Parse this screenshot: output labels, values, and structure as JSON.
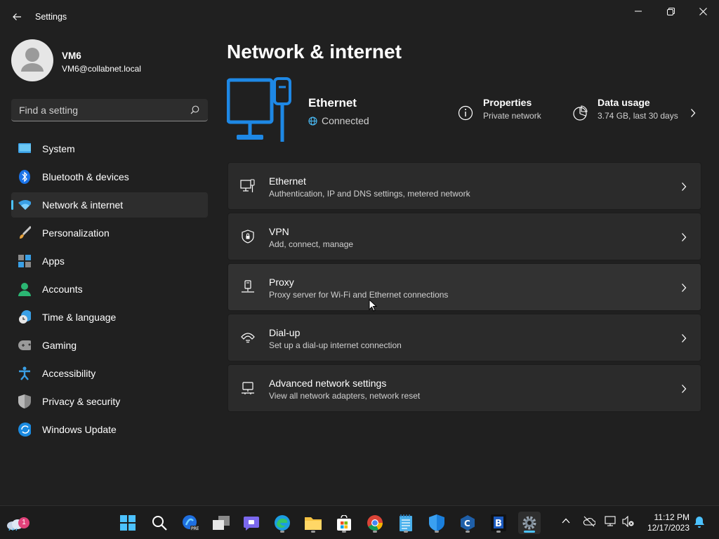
{
  "window": {
    "title": "Settings",
    "controls": {
      "minimize": "minimize",
      "maximize": "maximize",
      "close": "close"
    }
  },
  "user": {
    "name": "VM6",
    "email": "VM6@collabnet.local"
  },
  "search": {
    "placeholder": "Find a setting"
  },
  "nav": [
    {
      "label": "System",
      "icon": "system-icon",
      "active": false
    },
    {
      "label": "Bluetooth & devices",
      "icon": "bluetooth-icon",
      "active": false
    },
    {
      "label": "Network & internet",
      "icon": "wifi-icon",
      "active": true
    },
    {
      "label": "Personalization",
      "icon": "brush-icon",
      "active": false
    },
    {
      "label": "Apps",
      "icon": "apps-icon",
      "active": false
    },
    {
      "label": "Accounts",
      "icon": "accounts-icon",
      "active": false
    },
    {
      "label": "Time & language",
      "icon": "clock-globe-icon",
      "active": false
    },
    {
      "label": "Gaming",
      "icon": "gamepad-icon",
      "active": false
    },
    {
      "label": "Accessibility",
      "icon": "accessibility-icon",
      "active": false
    },
    {
      "label": "Privacy & security",
      "icon": "shield-icon",
      "active": false
    },
    {
      "label": "Windows Update",
      "icon": "update-icon",
      "active": false
    }
  ],
  "page": {
    "title": "Network & internet"
  },
  "hero": {
    "name": "Ethernet",
    "status": "Connected",
    "properties": {
      "title": "Properties",
      "subtitle": "Private network"
    },
    "data_usage": {
      "title": "Data usage",
      "subtitle": "3.74 GB, last 30 days"
    }
  },
  "cards": [
    {
      "title": "Ethernet",
      "subtitle": "Authentication, IP and DNS settings, metered network",
      "icon": "ethernet-icon"
    },
    {
      "title": "VPN",
      "subtitle": "Add, connect, manage",
      "icon": "vpn-shield-icon"
    },
    {
      "title": "Proxy",
      "subtitle": "Proxy server for Wi-Fi and Ethernet connections",
      "icon": "proxy-icon"
    },
    {
      "title": "Dial-up",
      "subtitle": "Set up a dial-up internet connection",
      "icon": "dialup-icon"
    },
    {
      "title": "Advanced network settings",
      "subtitle": "View all network adapters, network reset",
      "icon": "advanced-network-icon"
    }
  ],
  "taskbar": {
    "weather_badge": "1",
    "apps": [
      "start",
      "search",
      "copilot-pre",
      "task-view",
      "teams-chat",
      "edge",
      "file-explorer",
      "microsoft-store",
      "chrome",
      "notepad",
      "windows-security",
      "c-app",
      "b-app",
      "settings"
    ],
    "clock": {
      "time": "11:12 PM",
      "date": "12/17/2023"
    }
  },
  "colors": {
    "accent": "#4cc2ff",
    "background": "#202020",
    "card": "#2b2b2b"
  }
}
